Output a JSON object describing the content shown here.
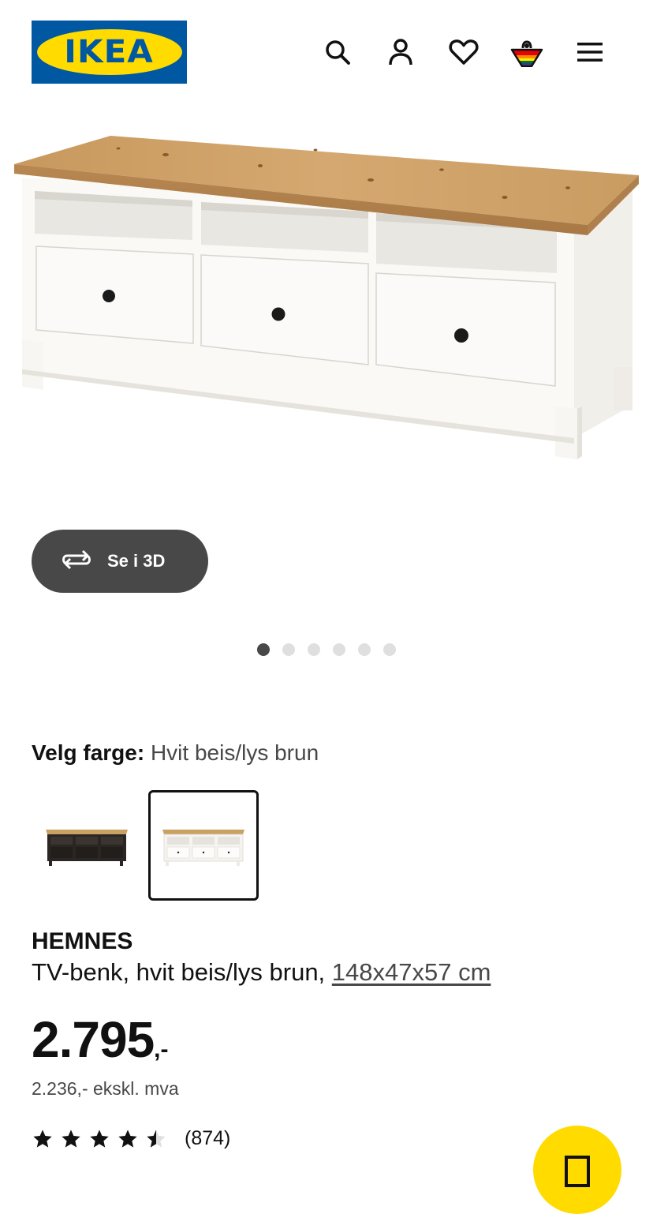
{
  "header": {
    "logo_text": "IKEA",
    "icons": [
      "search-icon",
      "account-icon",
      "heart-icon",
      "shopping-basket-icon",
      "menu-icon"
    ],
    "brand_blue": "#0058a3",
    "brand_yellow": "#ffdb00"
  },
  "gallery": {
    "view_3d_label": "Se i 3D",
    "slide_count": 6,
    "active_slide": 1
  },
  "color_selector": {
    "label": "Velg farge:",
    "selected_value": "Hvit beis/lys brun",
    "options": [
      "black-brown",
      "white-stain-light-brown"
    ],
    "selected_index": 1
  },
  "product": {
    "name": "HEMNES",
    "description": "TV-benk, hvit beis/lys brun,",
    "dimensions": "148x47x57 cm",
    "price": "2.795",
    "price_suffix": ",-",
    "price_ex_vat": "2.236,- ekskl. mva",
    "rating": 4.5,
    "rating_max": 5,
    "review_count": "(874)"
  },
  "colors": {
    "text_dark": "#111111",
    "text_muted": "#484848",
    "button_dark": "#484848",
    "fab_yellow": "#ffdb00"
  }
}
